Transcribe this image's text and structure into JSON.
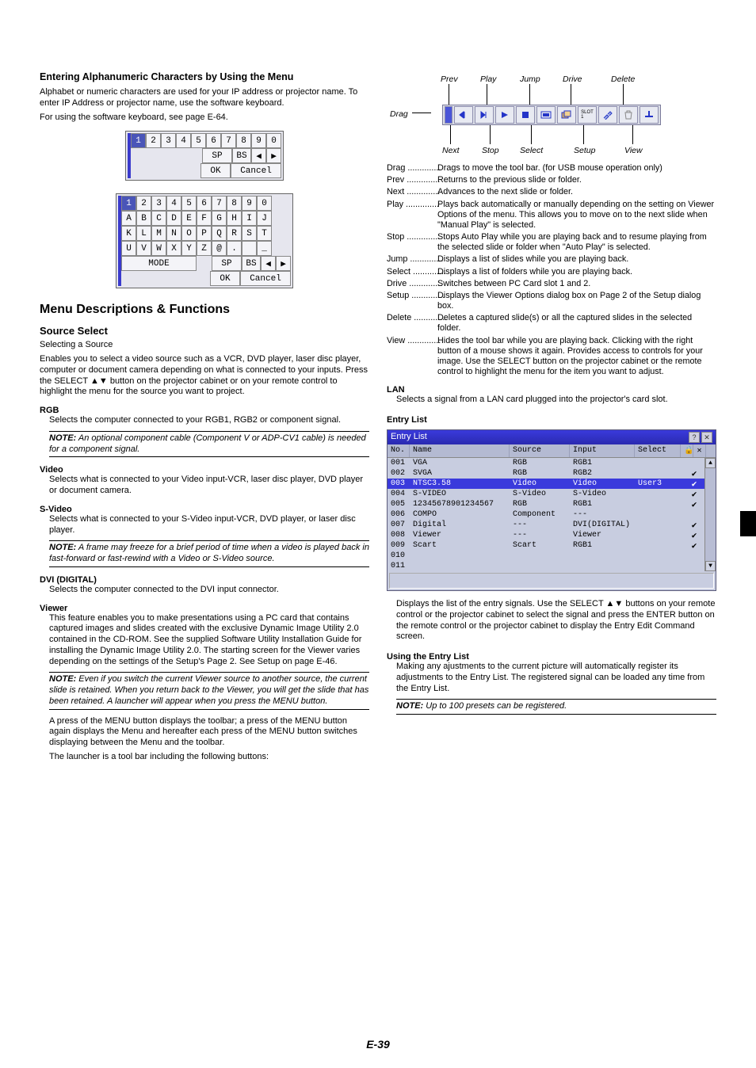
{
  "left": {
    "h_enter": "Entering Alphanumeric Characters by Using the Menu",
    "p_enter1": "Alphabet or numeric characters are used for your IP address or projector name. To enter IP Address or projector name, use the software keyboard.",
    "p_enter2": "For using the software keyboard, see page E-64.",
    "kb1": {
      "r1": [
        "1",
        "2",
        "3",
        "4",
        "5",
        "6",
        "7",
        "8",
        "9",
        "0"
      ],
      "r2_sp": "SP",
      "r2_bs": "BS",
      "r2_l": "◀",
      "r2_r": "▶",
      "r3_ok": "OK",
      "r3_cancel": "Cancel"
    },
    "kb2": {
      "r1": [
        "1",
        "2",
        "3",
        "4",
        "5",
        "6",
        "7",
        "8",
        "9",
        "0"
      ],
      "r2": [
        "A",
        "B",
        "C",
        "D",
        "E",
        "F",
        "G",
        "H",
        "I",
        "J"
      ],
      "r3": [
        "K",
        "L",
        "M",
        "N",
        "O",
        "P",
        "Q",
        "R",
        "S",
        "T"
      ],
      "r4": [
        "U",
        "V",
        "W",
        "X",
        "Y",
        "Z",
        "@",
        ".",
        "",
        "_"
      ],
      "mode": "MODE",
      "sp": "SP",
      "bs": "BS",
      "l": "◀",
      "r": "▶",
      "ok": "OK",
      "cancel": "Cancel"
    },
    "h_menu": "Menu Descriptions & Functions",
    "h_src": "Source Select",
    "p_selecting": "Selecting a Source",
    "p_src": "Enables you to select a video source such as a VCR, DVD player, laser disc player, computer or document camera depending on what is connected to your inputs. Press the SELECT ▲▼ button on the projector cabinet or on your remote control to highlight the menu for the source you want to project.",
    "rgb_h": "RGB",
    "rgb_p": "Selects the computer connected to your RGB1, RGB2 or component signal.",
    "rgb_note": "An optional component cable (Component V or ADP-CV1 cable) is needed for a component signal.",
    "video_h": "Video",
    "video_p": "Selects what is connected to your Video input-VCR, laser disc player, DVD player or document camera.",
    "svideo_h": "S-Video",
    "svideo_p": "Selects what is connected to your S-Video input-VCR, DVD player, or laser disc player.",
    "svideo_note": "A frame may freeze for a brief period of time when a video is played back in fast-forward or fast-rewind with a Video or S-Video source.",
    "dvi_h": "DVI (DIGITAL)",
    "dvi_p": "Selects the computer connected to the DVI input connector.",
    "viewer_h": "Viewer",
    "viewer_p": "This feature enables you to make presentations using a PC card that contains captured images and slides created with the exclusive Dynamic Image Utility 2.0 contained in the CD-ROM. See the supplied Software Utility Installation Guide for installing the Dynamic Image Utility 2.0. The starting screen for the Viewer varies depending on the settings of the Setup's Page 2. See Setup on page E-46.",
    "viewer_note": "Even if you switch the current Viewer source to another source, the current slide is retained. When you return back to the Viewer, you will get the slide that has been retained. A launcher will appear when you press the MENU button.",
    "viewer_p2": "A press of the MENU button displays the toolbar; a press of the MENU button again displays the Menu and hereafter each press of the MENU button switches displaying between the Menu and the toolbar.",
    "viewer_p3": "The launcher is a tool bar including the following buttons:"
  },
  "right": {
    "labels": {
      "prev": "Prev",
      "play": "Play",
      "jump": "Jump",
      "drive": "Drive",
      "delete": "Delete",
      "drag": "Drag",
      "next": "Next",
      "stop": "Stop",
      "select": "Select",
      "setup": "Setup",
      "view": "View"
    },
    "defs": {
      "drag": "Drags to move the tool bar. (for USB mouse operation only)",
      "prev": "Returns to the previous slide or folder.",
      "next": "Advances to the next slide or folder.",
      "play": "Plays back automatically or manually depending on the setting on Viewer Options of the menu. This allows you to move on to the next slide when \"Manual Play\" is selected.",
      "stop": "Stops Auto Play while you are playing back and to resume playing from the selected slide or folder when \"Auto Play\" is selected.",
      "jump": "Displays a list of slides while you are playing back.",
      "select": "Displays a list of folders while you are playing back.",
      "drive": "Switches between PC Card slot 1 and 2.",
      "setup": "Displays the Viewer Options dialog box on Page 2 of the Setup dialog box.",
      "delete": "Deletes a captured slide(s) or all the captured slides in the selected folder.",
      "view": "Hides the tool bar while you are playing back. Clicking with the right button of a mouse shows it again. Provides access to controls for your image. Use the SELECT button on the projector cabinet or the remote control to highlight the menu for the item you want to adjust."
    },
    "lan_h": "LAN",
    "lan_p": "Selects a signal from a LAN card plugged into the projector's card slot.",
    "el_h": "Entry List",
    "el_title": "Entry List",
    "el_cols": {
      "no": "No.",
      "name": "Name",
      "src": "Source",
      "inp": "Input",
      "sel": "Select",
      "lock": "🔒",
      "chk": "✕"
    },
    "el_rows": [
      {
        "no": "001",
        "name": "VGA",
        "src": "RGB",
        "inp": "RGB1",
        "sel": "",
        "chk": ""
      },
      {
        "no": "002",
        "name": "SVGA",
        "src": "RGB",
        "inp": "RGB2",
        "sel": "",
        "chk": "✔"
      },
      {
        "no": "003",
        "name": "NTSC3.58",
        "src": "Video",
        "inp": "Video",
        "sel": "User3",
        "chk": "✔",
        "hi": true
      },
      {
        "no": "004",
        "name": "S-VIDEO",
        "src": "S-Video",
        "inp": "S-Video",
        "sel": "",
        "chk": "✔"
      },
      {
        "no": "005",
        "name": "12345678901234567",
        "src": "RGB",
        "inp": "RGB1",
        "sel": "",
        "chk": "✔"
      },
      {
        "no": "006",
        "name": "COMPO",
        "src": "Component",
        "inp": "---",
        "sel": "",
        "chk": ""
      },
      {
        "no": "007",
        "name": "Digital",
        "src": "---",
        "inp": "DVI(DIGITAL)",
        "sel": "",
        "chk": "✔"
      },
      {
        "no": "008",
        "name": "Viewer",
        "src": "---",
        "inp": "Viewer",
        "sel": "",
        "chk": "✔"
      },
      {
        "no": "009",
        "name": "Scart",
        "src": "Scart",
        "inp": "RGB1",
        "sel": "",
        "chk": "✔"
      },
      {
        "no": "010",
        "name": "",
        "src": "",
        "inp": "",
        "sel": "",
        "chk": ""
      },
      {
        "no": "011",
        "name": "",
        "src": "",
        "inp": "",
        "sel": "",
        "chk": ""
      }
    ],
    "el_p": "Displays the list of the entry signals. Use the SELECT ▲▼ buttons on your remote control or the projector cabinet to select the signal and press the ENTER button on the remote control or the projector cabinet to display the Entry Edit Command screen.",
    "use_h": "Using the Entry List",
    "use_p": "Making any ajustments to the current picture will automatically register its adjustments to the Entry List. The registered signal can be loaded any time from the Entry List.",
    "use_note": "Up to 100 presets can be registered."
  },
  "note_label": "NOTE:",
  "page": "E-39"
}
